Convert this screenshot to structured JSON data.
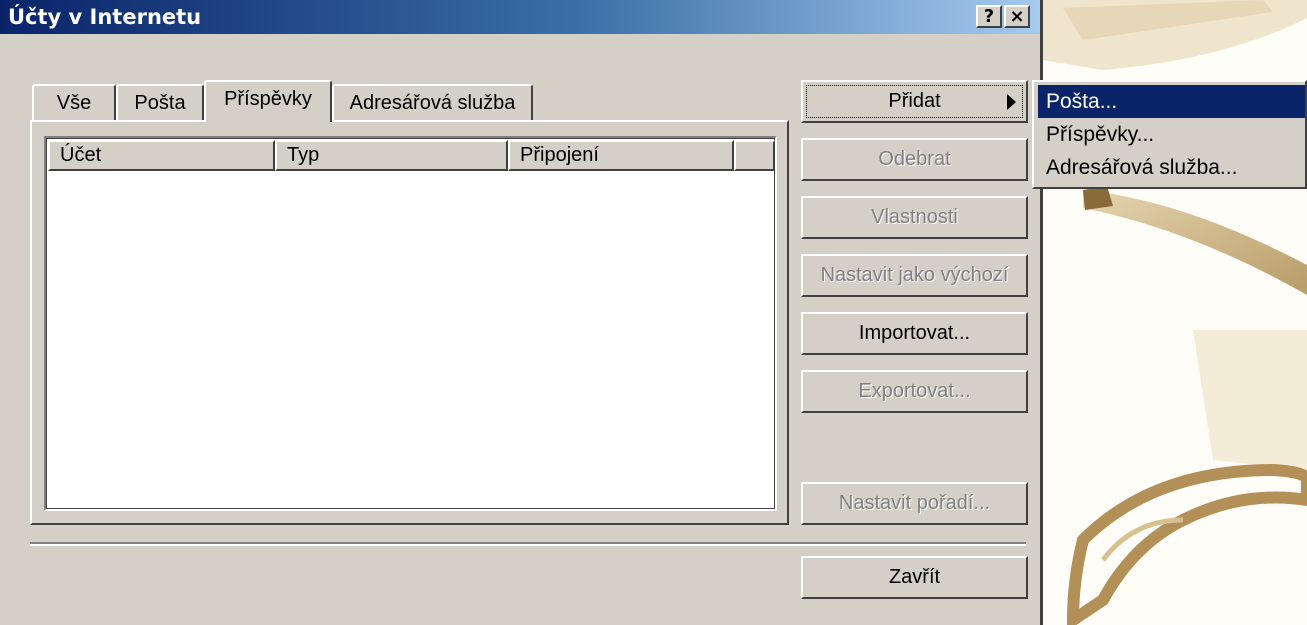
{
  "window": {
    "title": "Účty v Internetu",
    "help_label": "?",
    "close_label": "×"
  },
  "tabs": [
    {
      "label": "Vše"
    },
    {
      "label": "Pošta"
    },
    {
      "label": "Příspěvky",
      "active": true
    },
    {
      "label": "Adresářová služba"
    }
  ],
  "list": {
    "columns": [
      "Účet",
      "Typ",
      "Připojení"
    ]
  },
  "buttons": {
    "add": "Přidat",
    "remove": "Odebrat",
    "properties": "Vlastnosti",
    "set_default": "Nastavit jako výchozí",
    "import": "Importovat...",
    "export": "Exportovat...",
    "set_order": "Nastavit pořadí...",
    "close": "Zavřít"
  },
  "popup_menu": {
    "items": [
      "Pošta...",
      "Příspěvky...",
      "Adresářová služba..."
    ],
    "selected_index": 0
  },
  "colors": {
    "title_start": "#0a246a",
    "title_end": "#a6caf0",
    "face": "#d4d0c8",
    "highlight": "#0a246a"
  }
}
